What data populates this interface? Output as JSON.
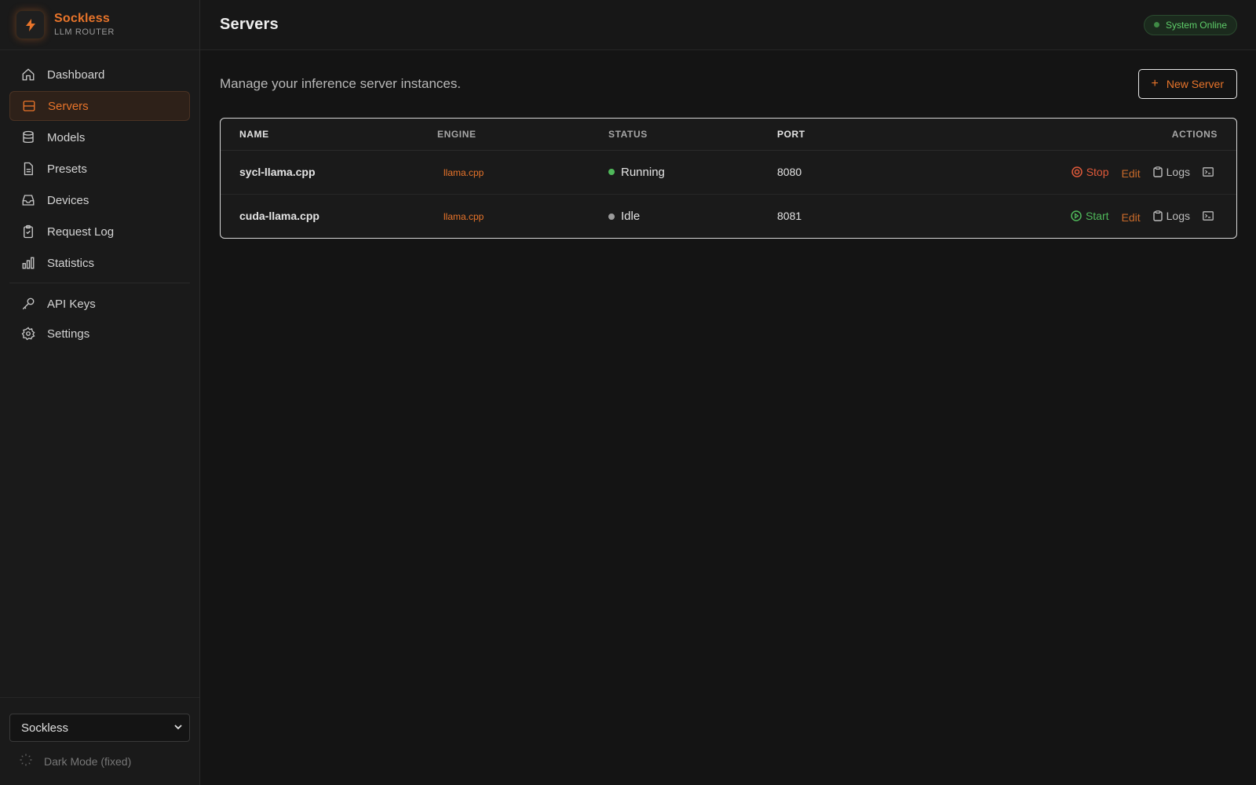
{
  "brand": {
    "name": "Sockless",
    "subtitle": "LLM ROUTER"
  },
  "sidebar": {
    "items": [
      {
        "label": "Dashboard",
        "icon": "home-icon"
      },
      {
        "label": "Servers",
        "icon": "server-icon",
        "active": true
      },
      {
        "label": "Models",
        "icon": "database-icon"
      },
      {
        "label": "Presets",
        "icon": "file-icon"
      },
      {
        "label": "Devices",
        "icon": "inbox-icon"
      },
      {
        "label": "Request Log",
        "icon": "clipboard-icon"
      },
      {
        "label": "Statistics",
        "icon": "bar-chart-icon"
      }
    ],
    "secondary": [
      {
        "label": "API Keys",
        "icon": "key-icon"
      },
      {
        "label": "Settings",
        "icon": "gear-icon"
      }
    ],
    "theme_select": {
      "value": "Sockless"
    },
    "dark_mode_label": "Dark Mode (fixed)"
  },
  "header": {
    "title": "Servers",
    "status": "System Online"
  },
  "main": {
    "intro": "Manage your inference server instances.",
    "new_button": "New Server",
    "table": {
      "columns": {
        "name": "NAME",
        "engine": "ENGINE",
        "status": "STATUS",
        "port": "PORT",
        "actions": "ACTIONS"
      },
      "rows": [
        {
          "name": "sycl-llama.cpp",
          "engine": "llama.cpp",
          "status": "Running",
          "port": "8080",
          "primary_action": "Stop",
          "edit": "Edit",
          "logs": "Logs"
        },
        {
          "name": "cuda-llama.cpp",
          "engine": "llama.cpp",
          "status": "Idle",
          "port": "8081",
          "primary_action": "Start",
          "edit": "Edit",
          "logs": "Logs"
        }
      ]
    }
  },
  "colors": {
    "accent": "#e8742a",
    "running": "#4fb85a",
    "idle": "#9a9a9a",
    "stop": "#e05a3a",
    "online": "#5fcf6a"
  }
}
